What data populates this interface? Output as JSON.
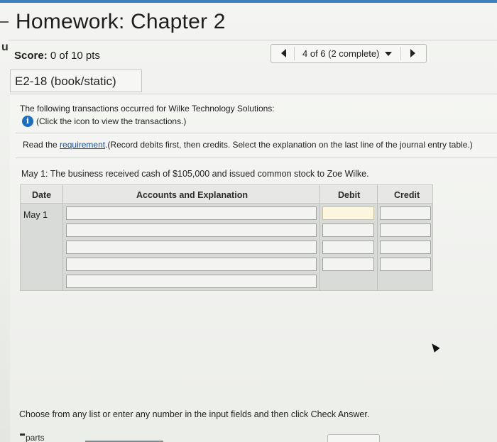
{
  "header": {
    "title": "Homework: Chapter 2",
    "left_fragment": "u",
    "score_label": "Score:",
    "score_value": "0 of 10 pts"
  },
  "pager": {
    "status": "4 of 6 (2 complete)"
  },
  "problem": {
    "id": "E2-18 (book/static)",
    "intro": "The following transactions occurred for Wilke Technology Solutions:",
    "info_link": "(Click the icon to view the transactions.)",
    "read_prefix": "Read the ",
    "requirement_link": "requirement",
    "read_suffix": ".(Record debits first, then credits. Select the explanation on the last line of the journal entry table.)",
    "transaction": "May 1: The business received cash of $105,000 and issued common stock to Zoe Wilke."
  },
  "journal": {
    "headers": {
      "date": "Date",
      "accounts": "Accounts and Explanation",
      "debit": "Debit",
      "credit": "Credit"
    },
    "date_value": "May 1",
    "rows": [
      {
        "account": "",
        "debit": "",
        "credit": ""
      },
      {
        "account": "",
        "debit": "",
        "credit": ""
      },
      {
        "account": "",
        "debit": "",
        "credit": ""
      },
      {
        "account": "",
        "debit": "",
        "credit": ""
      },
      {
        "explanation": ""
      }
    ]
  },
  "footer": {
    "hint": "Choose from any list or enter any number in the input fields and then click Check Answer.",
    "parts_label": "parts"
  },
  "colors": {
    "accent": "#3f7fbf",
    "info_icon": "#1b6ec2",
    "link": "#1b4fa0",
    "active_cell": "#fbf6dd"
  },
  "icons": [
    "prev-arrow-icon",
    "dropdown-caret-icon",
    "next-arrow-icon",
    "info-icon",
    "mouse-pointer-icon"
  ]
}
